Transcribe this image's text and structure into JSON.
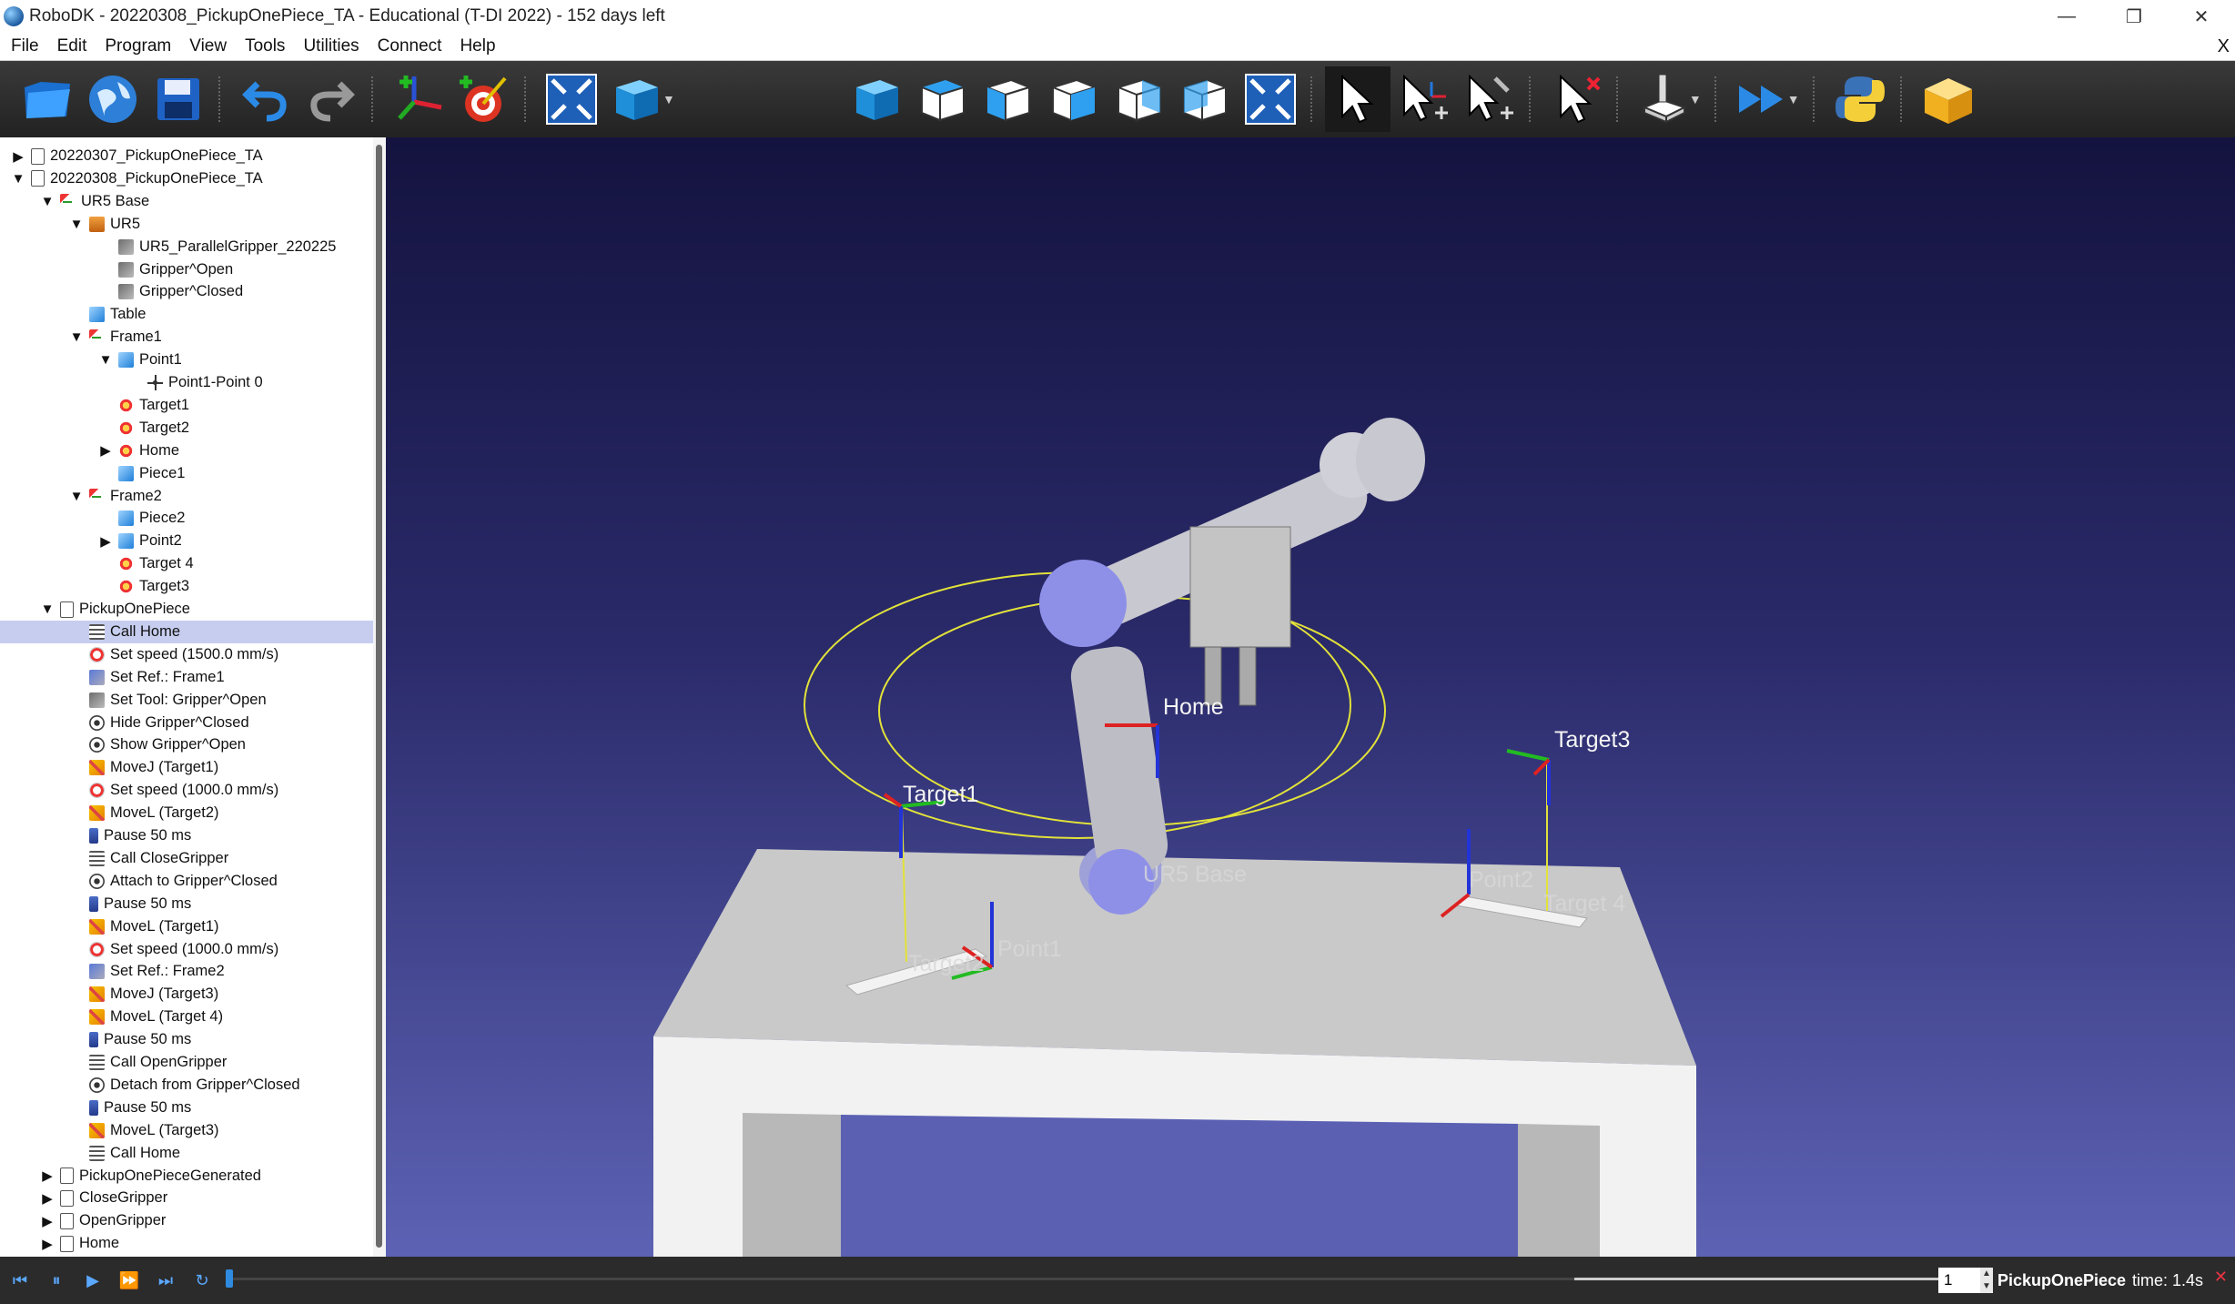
{
  "window": {
    "title": "RoboDK - 20220308_PickupOnePiece_TA - Educational (T-DI 2022) - 152 days left",
    "controls": {
      "minimize": "—",
      "restore": "❐",
      "close": "✕"
    }
  },
  "menu": {
    "items": [
      "File",
      "Edit",
      "Program",
      "View",
      "Tools",
      "Utilities",
      "Connect",
      "Help"
    ],
    "close": "X"
  },
  "toolbar": {
    "buttons": [
      "open-icon",
      "online-library-icon",
      "save-icon",
      "undo-icon",
      "redo-icon",
      "add-reference-frame-icon",
      "add-target-icon",
      "fit-all-icon",
      "display-object-icon",
      "iso-view-icon",
      "top-view-icon",
      "front-view-icon",
      "right-view-icon",
      "back-view-icon",
      "left-view-icon",
      "fit-view-icon",
      "select-icon",
      "move-reference-icon",
      "move-tool-icon",
      "delete-selection-icon",
      "jog-robot-icon",
      "fast-simulation-icon",
      "python-icon",
      "package-icon"
    ]
  },
  "tree": {
    "items": [
      {
        "label": "20220307_PickupOnePiece_TA",
        "indent": 0,
        "icon": "station-icon",
        "expander": "▶"
      },
      {
        "label": "20220308_PickupOnePiece_TA",
        "indent": 0,
        "icon": "station-icon",
        "expander": "▼"
      },
      {
        "label": "UR5 Base",
        "indent": 1,
        "icon": "frame-icon",
        "expander": "▼"
      },
      {
        "label": "UR5",
        "indent": 2,
        "icon": "robot-icon",
        "expander": "▼"
      },
      {
        "label": "UR5_ParallelGripper_220225",
        "indent": 3,
        "icon": "tool-icon",
        "expander": ""
      },
      {
        "label": "Gripper^Open",
        "indent": 3,
        "icon": "tool-icon",
        "expander": ""
      },
      {
        "label": "Gripper^Closed",
        "indent": 3,
        "icon": "tool-icon",
        "expander": ""
      },
      {
        "label": "Table",
        "indent": 2,
        "icon": "object-icon",
        "expander": ""
      },
      {
        "label": "Frame1",
        "indent": 2,
        "icon": "frame-icon",
        "expander": "▼"
      },
      {
        "label": "Point1",
        "indent": 3,
        "icon": "object-icon",
        "expander": "▼"
      },
      {
        "label": "Point1-Point 0",
        "indent": 4,
        "icon": "point-icon",
        "expander": ""
      },
      {
        "label": "Target1",
        "indent": 3,
        "icon": "target-icon",
        "expander": ""
      },
      {
        "label": "Target2",
        "indent": 3,
        "icon": "target-icon",
        "expander": ""
      },
      {
        "label": "Home",
        "indent": 3,
        "icon": "target-icon",
        "expander": "▶"
      },
      {
        "label": "Piece1",
        "indent": 3,
        "icon": "object-icon",
        "expander": ""
      },
      {
        "label": "Frame2",
        "indent": 2,
        "icon": "frame-icon",
        "expander": "▼"
      },
      {
        "label": "Piece2",
        "indent": 3,
        "icon": "object-icon",
        "expander": ""
      },
      {
        "label": "Point2",
        "indent": 3,
        "icon": "object-icon",
        "expander": "▶"
      },
      {
        "label": "Target 4",
        "indent": 3,
        "icon": "target-icon",
        "expander": ""
      },
      {
        "label": "Target3",
        "indent": 3,
        "icon": "target-icon",
        "expander": ""
      },
      {
        "label": "PickupOnePiece",
        "indent": 1,
        "icon": "program-icon",
        "expander": "▼"
      },
      {
        "label": "Call Home",
        "indent": 2,
        "icon": "call-icon",
        "expander": "",
        "selected": true
      },
      {
        "label": "Set speed (1500.0 mm/s)",
        "indent": 2,
        "icon": "speed-icon",
        "expander": ""
      },
      {
        "label": "Set Ref.: Frame1",
        "indent": 2,
        "icon": "set-ref-icon",
        "expander": ""
      },
      {
        "label": "Set Tool: Gripper^Open",
        "indent": 2,
        "icon": "set-tool-icon",
        "expander": ""
      },
      {
        "label": "Hide Gripper^Closed",
        "indent": 2,
        "icon": "eye-icon",
        "expander": ""
      },
      {
        "label": "Show Gripper^Open",
        "indent": 2,
        "icon": "eye-icon",
        "expander": ""
      },
      {
        "label": "MoveJ (Target1)",
        "indent": 2,
        "icon": "move-icon",
        "expander": ""
      },
      {
        "label": "Set speed (1000.0 mm/s)",
        "indent": 2,
        "icon": "speed-icon",
        "expander": ""
      },
      {
        "label": "MoveL (Target2)",
        "indent": 2,
        "icon": "move-icon",
        "expander": ""
      },
      {
        "label": "Pause 50 ms",
        "indent": 2,
        "icon": "pause-icon",
        "expander": ""
      },
      {
        "label": "Call CloseGripper",
        "indent": 2,
        "icon": "call-icon",
        "expander": ""
      },
      {
        "label": "Attach to Gripper^Closed",
        "indent": 2,
        "icon": "eye-icon",
        "expander": ""
      },
      {
        "label": "Pause 50 ms",
        "indent": 2,
        "icon": "pause-icon",
        "expander": ""
      },
      {
        "label": "MoveL (Target1)",
        "indent": 2,
        "icon": "move-icon",
        "expander": ""
      },
      {
        "label": "Set speed (1000.0 mm/s)",
        "indent": 2,
        "icon": "speed-icon",
        "expander": ""
      },
      {
        "label": "Set Ref.: Frame2",
        "indent": 2,
        "icon": "set-ref-icon",
        "expander": ""
      },
      {
        "label": "MoveJ (Target3)",
        "indent": 2,
        "icon": "move-icon",
        "expander": ""
      },
      {
        "label": "MoveL (Target 4)",
        "indent": 2,
        "icon": "move-icon",
        "expander": ""
      },
      {
        "label": "Pause 50 ms",
        "indent": 2,
        "icon": "pause-icon",
        "expander": ""
      },
      {
        "label": "Call OpenGripper",
        "indent": 2,
        "icon": "call-icon",
        "expander": ""
      },
      {
        "label": "Detach from Gripper^Closed",
        "indent": 2,
        "icon": "eye-icon",
        "expander": ""
      },
      {
        "label": "Pause 50 ms",
        "indent": 2,
        "icon": "pause-icon",
        "expander": ""
      },
      {
        "label": "MoveL (Target3)",
        "indent": 2,
        "icon": "move-icon",
        "expander": ""
      },
      {
        "label": "Call Home",
        "indent": 2,
        "icon": "call-icon",
        "expander": ""
      },
      {
        "label": "PickupOnePieceGenerated",
        "indent": 1,
        "icon": "program-icon",
        "expander": "▶"
      },
      {
        "label": "CloseGripper",
        "indent": 1,
        "icon": "program-icon",
        "expander": "▶"
      },
      {
        "label": "OpenGripper",
        "indent": 1,
        "icon": "program-icon",
        "expander": "▶"
      },
      {
        "label": "Home",
        "indent": 1,
        "icon": "program-icon",
        "expander": "▶"
      }
    ]
  },
  "viewport": {
    "labels": {
      "home": "Home",
      "target1": "Target1",
      "target3": "Target3",
      "ur5_base": "UR5 Base",
      "point2": "Point2",
      "target4": "Target 4",
      "point1": "Point1",
      "target2": "Target2"
    }
  },
  "bottombar": {
    "controls": [
      "skip-back-icon",
      "pause-icon",
      "play-icon",
      "fast-forward-icon",
      "skip-forward-icon",
      "loop-icon"
    ],
    "spin_value": "1",
    "program_name": "PickupOnePiece",
    "program_time": "time: 1.4s",
    "close": "✕"
  }
}
